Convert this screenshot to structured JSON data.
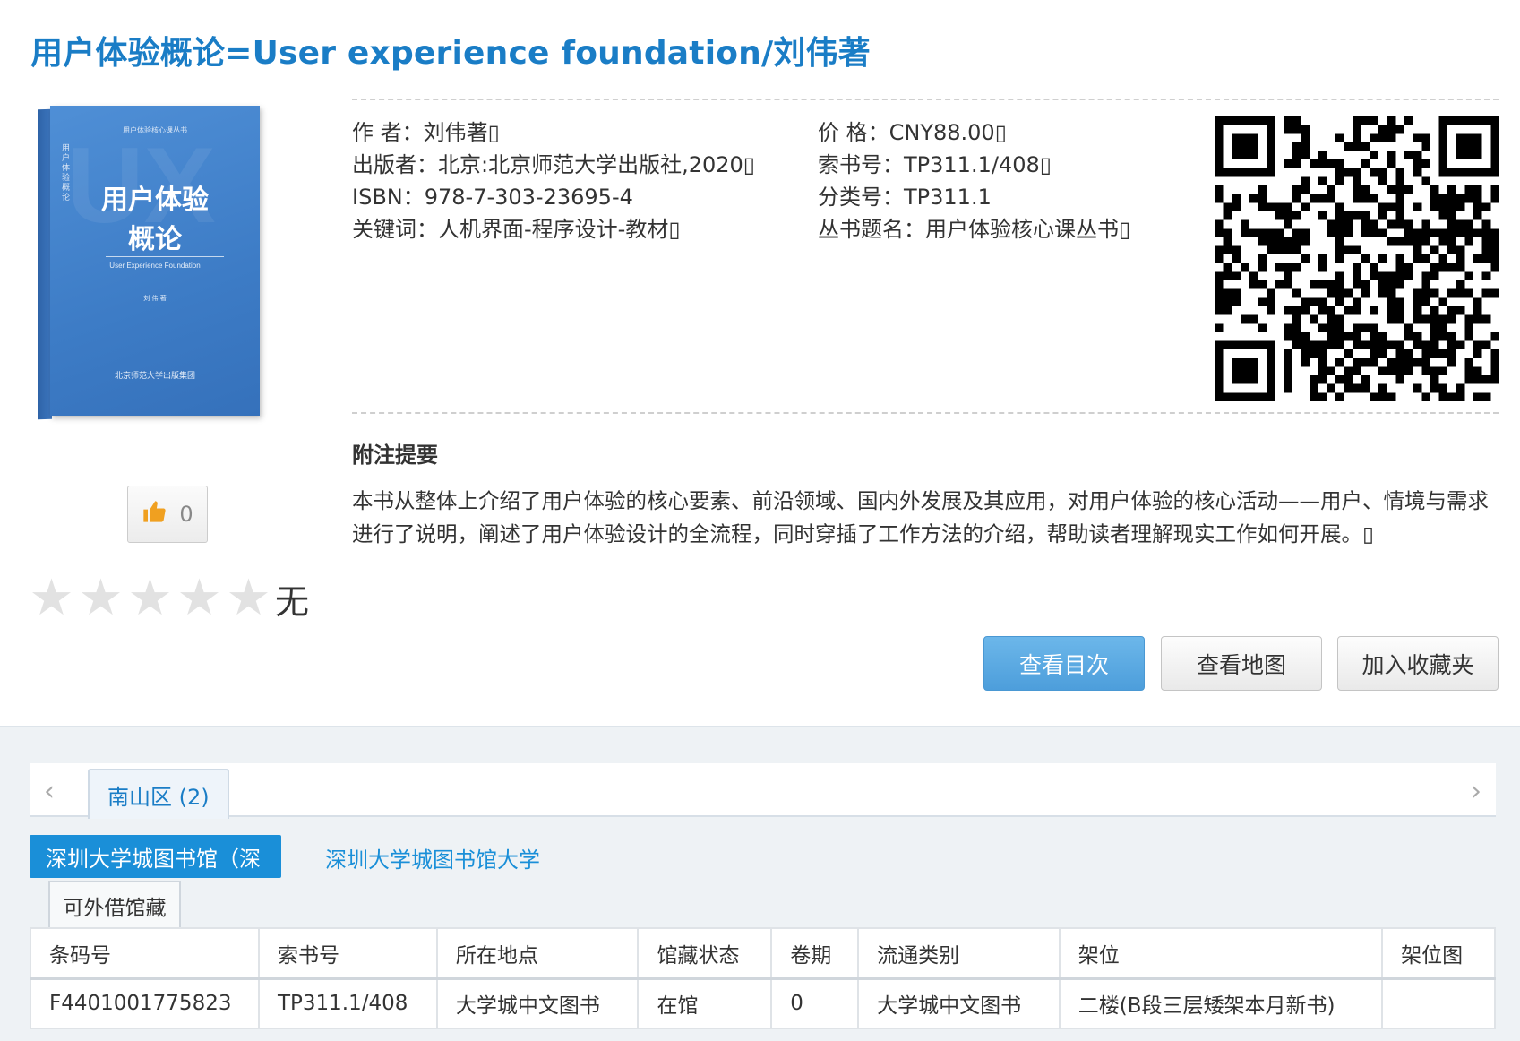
{
  "title": "用户体验概论=User experience foundation/刘伟著",
  "cover": {
    "series": "用户体验核心课丛书",
    "title_line1": "用户体验",
    "title_line2": "概论",
    "subtitle": "User Experience Foundation",
    "author": "刘 伟 著",
    "vertical_text": "用户体验概论",
    "watermark": "UX",
    "publisher": "北京师范大学出版集团"
  },
  "like": {
    "count": "0"
  },
  "rating": {
    "stars": 0,
    "max": 5,
    "text": "无"
  },
  "meta_left": [
    "作 者：刘伟著▯",
    "出版者：北京:北京师范大学出版社,2020▯",
    "ISBN：978-7-303-23695-4",
    "关键词：人机界面-程序设计-教材▯"
  ],
  "meta_right": [
    "价 格：CNY88.00▯",
    "索书号：TP311.1/408▯",
    "分类号：TP311.1",
    "丛书题名：用户体验核心课丛书▯"
  ],
  "abstract": {
    "heading": "附注提要",
    "text": "本书从整体上介绍了用户体验的核心要素、前沿领域、国内外发展及其应用，对用户体验的核心活动——用户、情境与需求进行了说明，阐述了用户体验设计的全流程，同时穿插了工作方法的介绍，帮助读者理解现实工作如何开展。▯"
  },
  "buttons": {
    "toc": "查看目次",
    "map": "查看地图",
    "favorite": "加入收藏夹"
  },
  "holdings": {
    "region_tab": "南山区 (2)",
    "libraries": [
      "深圳大学城图书馆（深",
      "深圳大学城图书馆大学"
    ],
    "sub_tab": "可外借馆藏",
    "columns": [
      "条码号",
      "索书号",
      "所在地点",
      "馆藏状态",
      "卷期",
      "流通类别",
      "架位",
      "架位图"
    ],
    "rows": [
      [
        "F4401001775823",
        "TP311.1/408",
        "大学城中文图书",
        "在馆",
        "0",
        "大学城中文图书",
        "二楼(B段三层矮架本月新书)",
        ""
      ]
    ]
  },
  "colors": {
    "accent": "#1a7dc6",
    "primary_button": "#4d9edb",
    "cover_blue": "#3d7cc6"
  }
}
